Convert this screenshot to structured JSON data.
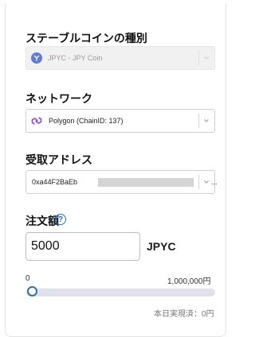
{
  "stablecoin": {
    "label": "ステーブルコインの種別",
    "selected": "JPYC - JPY Coin",
    "icon": "coin-icon"
  },
  "network": {
    "label": "ネットワーク",
    "selected": "Polygon (ChainID: 137)",
    "icon": "polygon-icon"
  },
  "address": {
    "label": "受取アドレス",
    "value_visible": "0xa44F2BaEb",
    "value_suffix": "..."
  },
  "order": {
    "label": "注文額",
    "help_icon": "?",
    "amount": "5000",
    "unit": "JPYC",
    "range_min": "0",
    "range_max": "1,000,000円",
    "slider_fraction": 0.005,
    "daily_limit_text": "本日実現済：0円"
  },
  "colors": {
    "accent": "#2e6fb8",
    "help": "#1a73c8",
    "polygon": "#8247e5"
  }
}
